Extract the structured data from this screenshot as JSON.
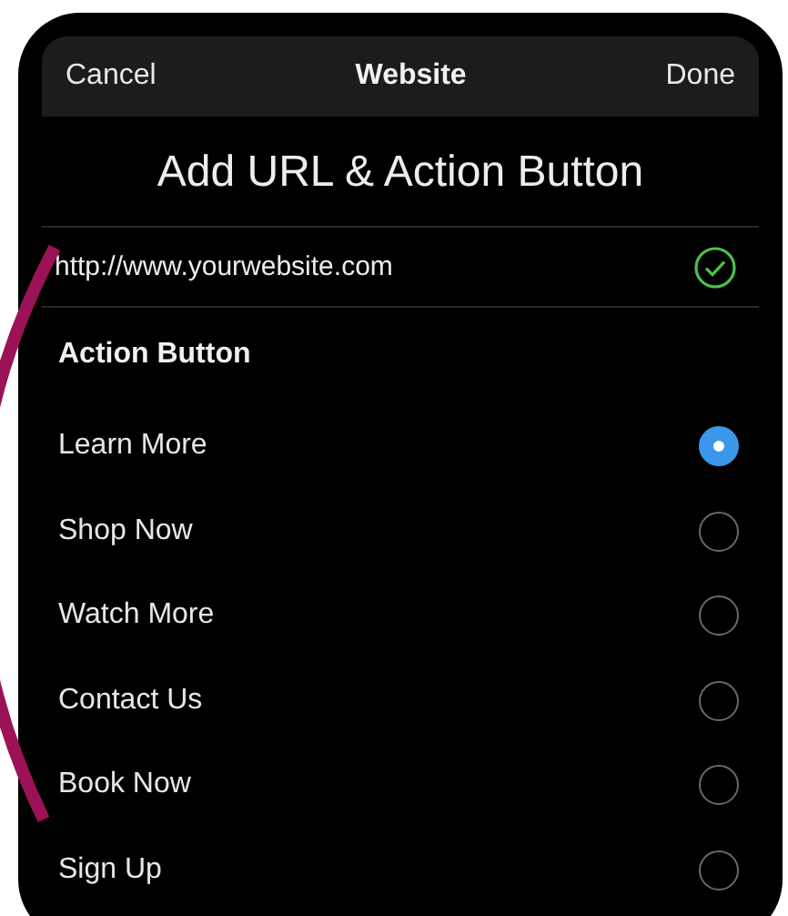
{
  "nav": {
    "cancel": "Cancel",
    "title": "Website",
    "done": "Done"
  },
  "heading": "Add URL & Action Button",
  "url": {
    "value": "http://www.yourwebsite.com",
    "valid": true
  },
  "section_title": "Action Button",
  "options": [
    {
      "label": "Learn More",
      "selected": true
    },
    {
      "label": "Shop Now",
      "selected": false
    },
    {
      "label": "Watch More",
      "selected": false
    },
    {
      "label": "Contact Us",
      "selected": false
    },
    {
      "label": "Book Now",
      "selected": false
    },
    {
      "label": "Sign Up",
      "selected": false
    }
  ]
}
